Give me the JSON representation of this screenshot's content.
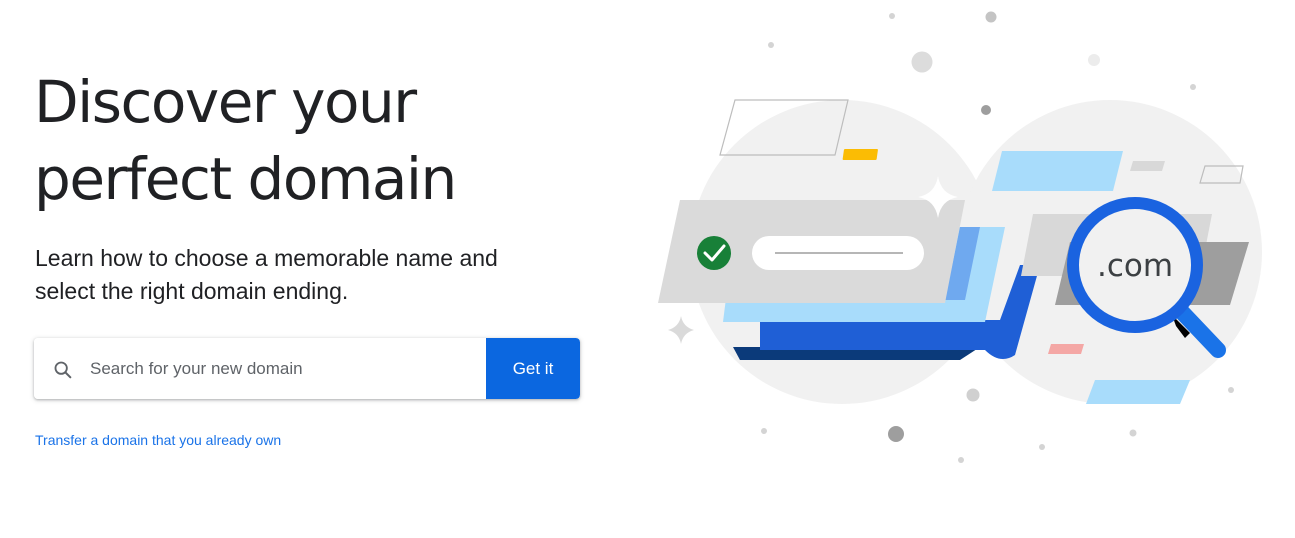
{
  "hero": {
    "title_line1": "Discover your",
    "title_line2": "perfect domain",
    "subtitle_line1": "Learn how to choose a memorable name and",
    "subtitle_line2": "select the right domain ending."
  },
  "search": {
    "placeholder": "Search for your new domain",
    "value": "",
    "button_label": "Get it"
  },
  "links": {
    "transfer": "Transfer a domain that you already own"
  },
  "illustration": {
    "magnifier_text": ".com",
    "icons": [
      "checkmark-icon",
      "magnifier-icon",
      "sparkle-icon"
    ]
  },
  "colors": {
    "accent": "#0b67e0",
    "link": "#1a73e8",
    "text": "#202124",
    "check_green": "#188038",
    "light_blue": "#a8dcfb",
    "mid_blue": "#1a73e8",
    "navy": "#0b3a7a",
    "gray_disc": "#f1f1f1"
  }
}
